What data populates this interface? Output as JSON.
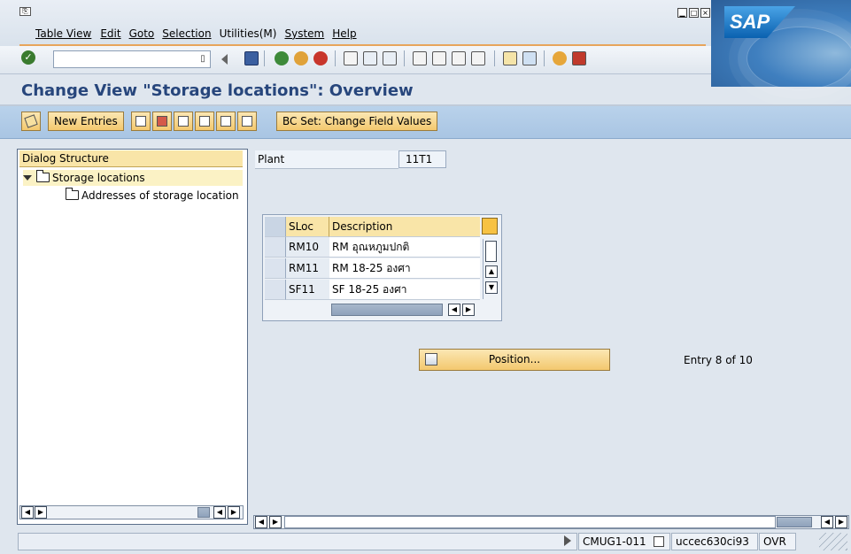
{
  "menu": [
    "Table View",
    "Edit",
    "Goto",
    "Selection",
    "Utilities(M)",
    "System",
    "Help"
  ],
  "brand": "SAP",
  "screen_title": "Change View \"Storage locations\": Overview",
  "app_toolbar": {
    "new_entries": "New Entries",
    "bc_set": "BC Set: Change Field Values"
  },
  "dialog_structure": {
    "header": "Dialog Structure",
    "items": [
      "Storage locations",
      "Addresses of storage location"
    ]
  },
  "plant": {
    "label": "Plant",
    "value": "11T1"
  },
  "table": {
    "columns": [
      "SLoc",
      "Description"
    ],
    "rows": [
      {
        "sloc": "RM10",
        "desc": "RM อุณหภูมปกติ"
      },
      {
        "sloc": "RM11",
        "desc": "RM 18-25 องศา"
      },
      {
        "sloc": "SF11",
        "desc": "SF 18-25 องศา"
      }
    ]
  },
  "position_button": "Position...",
  "entry_text": "Entry 8 of 10",
  "status": {
    "system": "CMUG1-011",
    "client": "uccec630ci93",
    "mode": "OVR"
  },
  "colors": {
    "title": "#27467c",
    "button_bg": "#f3c86e",
    "app_toolbar_bg": "#b9d2eb",
    "header_bg": "#f9e5a8"
  }
}
